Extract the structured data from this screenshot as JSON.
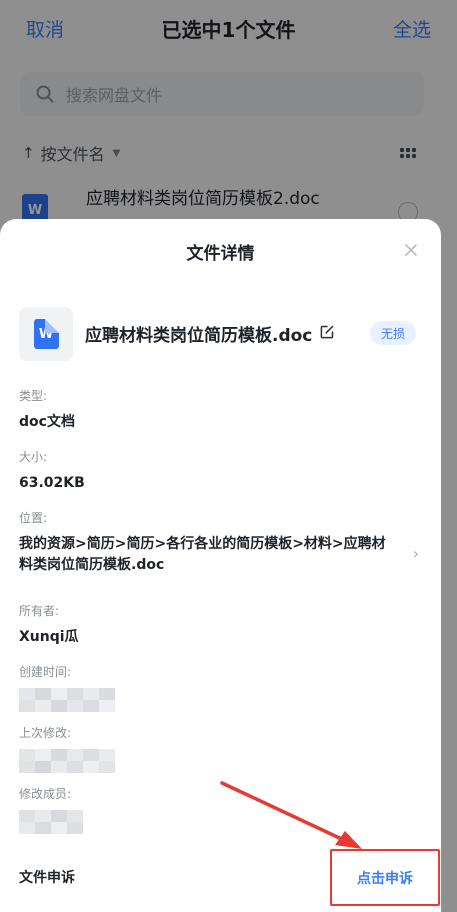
{
  "background": {
    "cancel_label": "取消",
    "title": "已选中1个文件",
    "select_all_label": "全选",
    "search_placeholder": "搜索网盘文件",
    "sort_label": "按文件名",
    "file_name": "应聘材料类岗位简历模板2.doc"
  },
  "sheet": {
    "title": "文件详情",
    "file_name": "应聘材料类岗位简历模板.doc",
    "badge": "无损",
    "doc_icon_letter": "W",
    "type_label": "类型:",
    "type_value": "doc文档",
    "size_label": "大小:",
    "size_value": "63.02KB",
    "location_label": "位置:",
    "location_value": "我的资源>简历>简历>各行各业的简历模板>材料>应聘材料类岗位简历模板.doc",
    "owner_label": "所有者:",
    "owner_value": "Xunqi瓜",
    "created_label": "创建时间:",
    "modified_label": "上次修改:",
    "modifier_label": "修改成员:",
    "appeal_row_label": "文件申诉",
    "appeal_button": "点击申诉"
  },
  "colors": {
    "accent": "#3b7df7",
    "annotation_red": "#e63a32"
  },
  "icons": [
    "search-icon",
    "sort-arrow-icon",
    "grid-view-icon",
    "doc-file-icon",
    "close-icon",
    "edit-icon",
    "chevron-right-icon"
  ]
}
